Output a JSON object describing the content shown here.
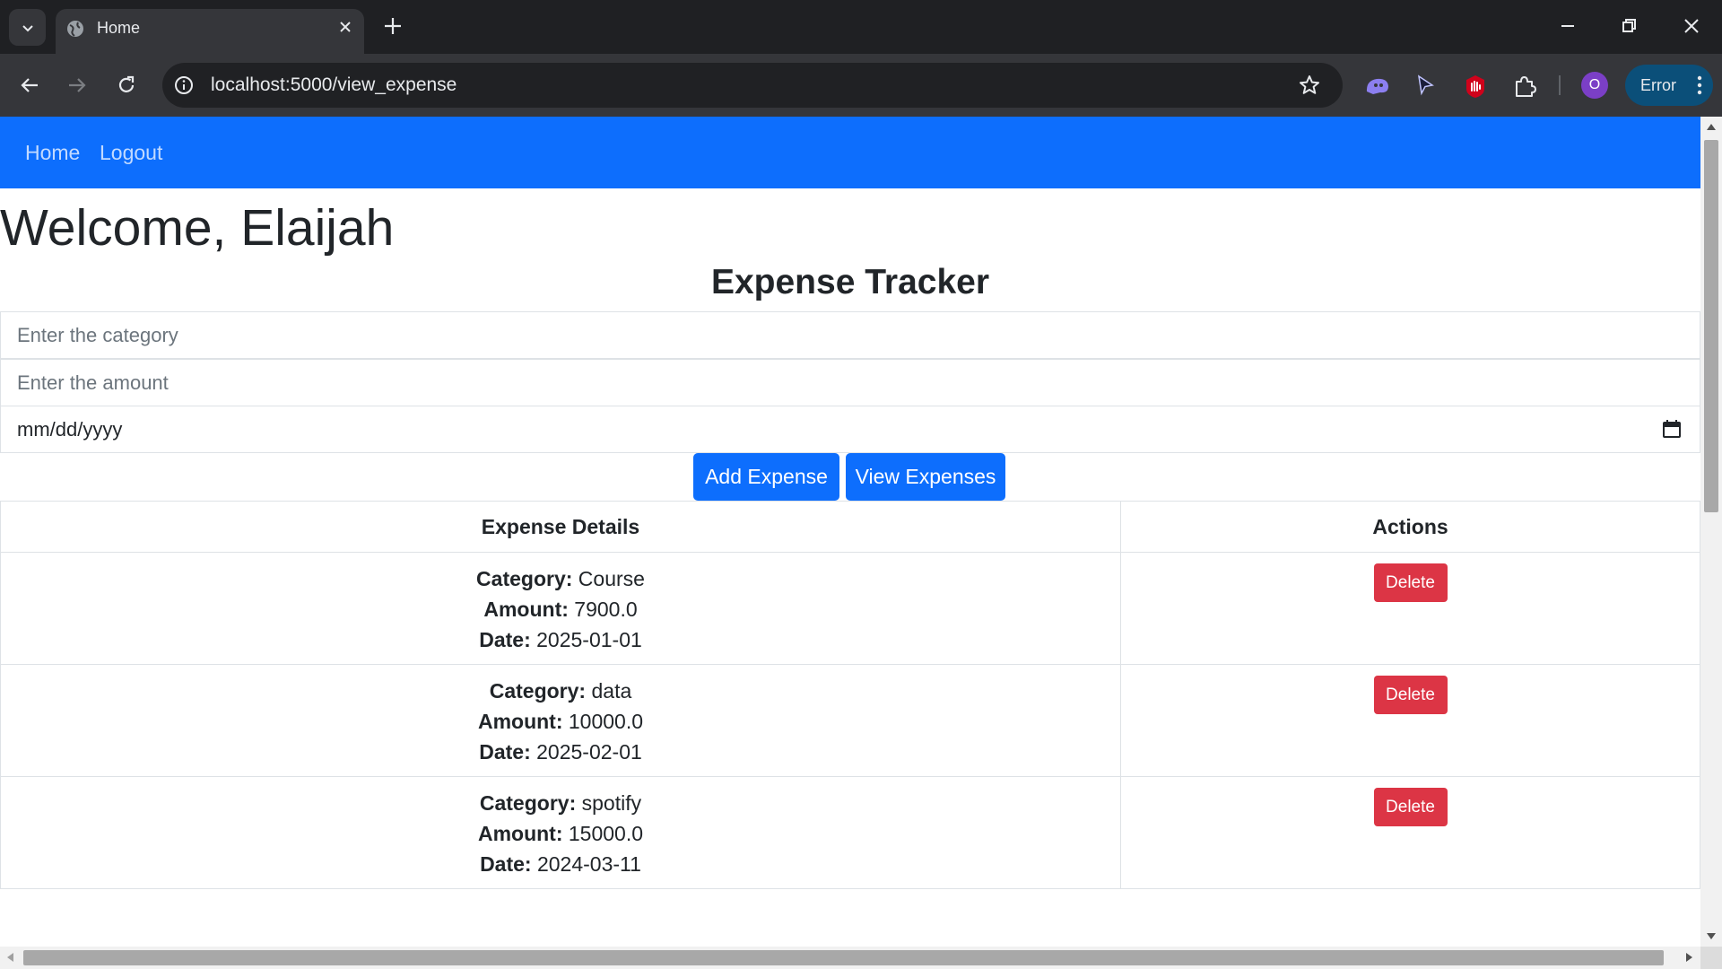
{
  "browser": {
    "tab_title": "Home",
    "url": "localhost:5000/view_expense",
    "profile_initial": "O",
    "error_label": "Error"
  },
  "navbar": {
    "links": [
      "Home",
      "Logout"
    ]
  },
  "welcome": "Welcome, Elaijah",
  "app_title": "Expense Tracker",
  "form": {
    "category_placeholder": "Enter the category",
    "amount_placeholder": "Enter the amount",
    "date_placeholder": "mm/dd/yyyy",
    "add_label": "Add Expense",
    "view_label": "View Expenses"
  },
  "table": {
    "headers": [
      "Expense Details",
      "Actions"
    ],
    "field_labels": {
      "category": "Category:",
      "amount": "Amount:",
      "date": "Date:"
    },
    "delete_label": "Delete",
    "rows": [
      {
        "category": "Course",
        "amount": "7900.0",
        "date": "2025-01-01"
      },
      {
        "category": "data",
        "amount": "10000.0",
        "date": "2025-02-01"
      },
      {
        "category": "spotify",
        "amount": "15000.0",
        "date": "2024-03-11"
      }
    ]
  },
  "colors": {
    "primary": "#0d6efd",
    "danger": "#dc3545",
    "chrome_dark": "#1f2023"
  }
}
